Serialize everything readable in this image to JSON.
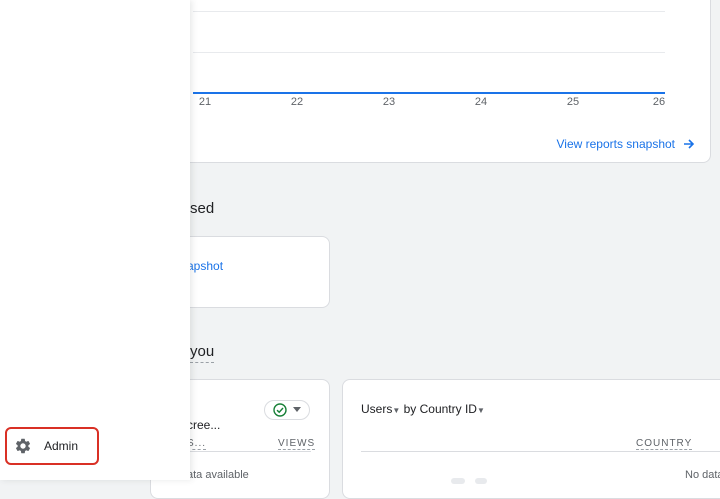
{
  "chart": {
    "x_ticks": [
      "21",
      "22",
      "23",
      "24",
      "25",
      "26"
    ],
    "view_link": "View reports snapshot"
  },
  "sections": {
    "recent_title": "sed",
    "suggested_title": "you"
  },
  "snapshot_card": {
    "link": "apshot"
  },
  "left_card": {
    "title": "cree...",
    "col_left": "S...",
    "col_right": "VIEWS",
    "no_data": "ata available"
  },
  "right_card": {
    "title_metric": "Users",
    "title_by": "by Country ID",
    "col": "COUNTRY",
    "no_data": "No data"
  },
  "nav": {
    "admin_label": "Admin"
  },
  "colors": {
    "accent": "#1a73e8",
    "highlight": "#d93025",
    "check": "#188038"
  }
}
